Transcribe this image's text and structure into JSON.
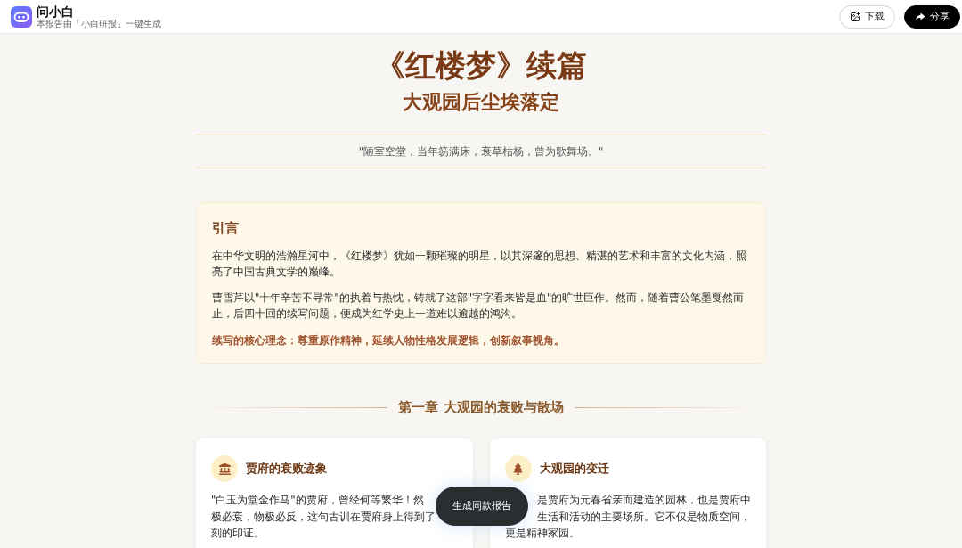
{
  "header": {
    "app_name": "问小白",
    "tagline": "本报告由「小白研报」一键生成",
    "buttons": [
      {
        "label": "下载",
        "kind": "outline"
      },
      {
        "label": "分享",
        "kind": "solid"
      }
    ]
  },
  "hero": {
    "title": "《红楼梦》续篇",
    "subtitle": "大观园后尘埃落定",
    "quote": "\"陋室空堂，当年笏满床，衰草枯杨，曾为歌舞场。\""
  },
  "intro": {
    "heading": "引言",
    "paragraphs": [
      "在中华文明的浩瀚星河中，《红楼梦》犹如一颗璀璨的明星，以其深邃的思想、精湛的艺术和丰富的文化内涵，照亮了中国古典文学的巅峰。",
      "曹雪芹以\"十年辛苦不寻常\"的执着与热忱，铸就了这部\"字字看来皆是血\"的旷世巨作。然而，随着曹公笔墨戛然而止，后四十回的续写问题，便成为红学史上一道难以逾越的鸿沟。"
    ],
    "emphasis": "续写的核心理念：尊重原作精神，延续人物性格发展逻辑，创新叙事视角。"
  },
  "chapter": {
    "heading": "第一章 大观园的衰败与散场",
    "cards": [
      {
        "title": "贾府的衰败迹象",
        "lines": [
          {
            "text": "\"白玉为堂金作马\"的贾府，曾经何等繁华！然",
            "obscured_start": false
          },
          {
            "text": "极必衰，物极必反，这句古训在贾府身上得到了",
            "obscured_start": false
          },
          {
            "text": "刻的印证。",
            "obscured_start": false
          }
        ]
      },
      {
        "title": "大观园的变迁",
        "lines": [
          {
            "text": "是贾府为元春省亲而建造的园林，也是贾府中",
            "obscured_start": true
          },
          {
            "text": "生活和活动的主要场所。它不仅是物质空间，",
            "obscured_start": true
          },
          {
            "text": "更是精神家园。",
            "obscured_start": false
          }
        ]
      }
    ]
  },
  "floating_button": {
    "label": "生成同款报告"
  }
}
